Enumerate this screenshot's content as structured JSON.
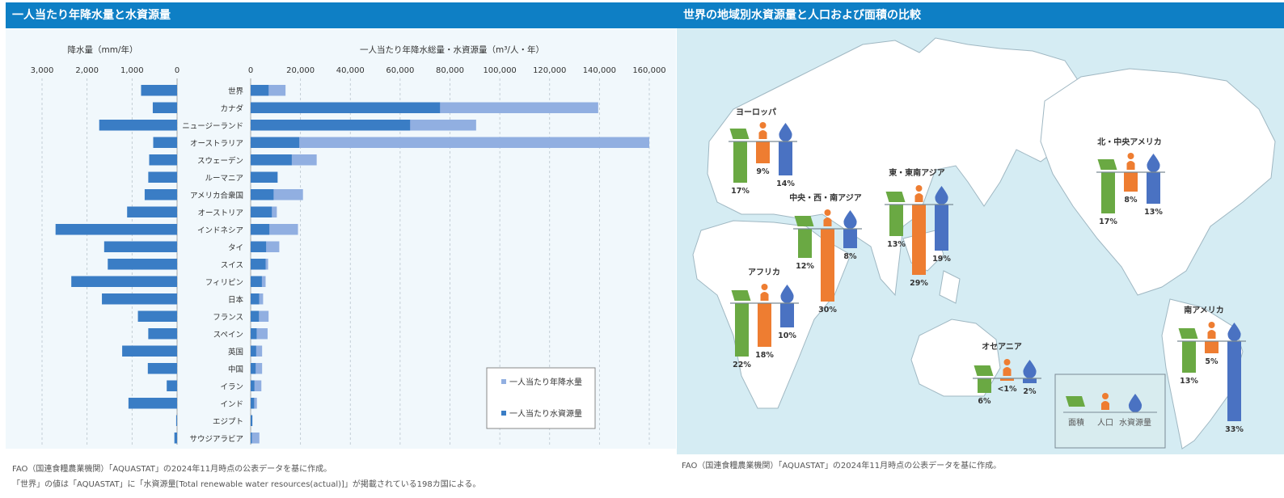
{
  "left_panel": {
    "title": "一人当たり年降水量と水資源量"
  },
  "right_panel": {
    "title": "世界の地域別水資源量と人口および面積の比較"
  },
  "notes": {
    "left_line1": "FAO（国連食糧農業機関）「AQUASTAT」の2024年11月時点の公表データを基に作成。",
    "left_line2": "「世界」の値は「AQUASTAT」に「水資源量[Total renewable water resources(actual)]」が掲載されている198カ国による。",
    "right_line1": "FAO（国連食糧農業機関）「AQUASTAT」の2024年11月時点の公表データを基に作成。"
  },
  "colors": {
    "resource": "#3a7dc5",
    "precip": "#91afe1",
    "area": "#6aa943",
    "population": "#ee7d31",
    "water": "#4a72c2"
  },
  "chart_data": [
    {
      "type": "bar",
      "orientation": "horizontal-reversed",
      "xlabel": "降水量（mm/年）",
      "xlim": [
        0,
        3000
      ],
      "ticks": [
        "3,000",
        "2,000",
        "1,000",
        "0"
      ],
      "tick_values": [
        3000,
        2000,
        1000,
        0
      ],
      "grid": true,
      "categories": [
        "世界",
        "カナダ",
        "ニュージーランド",
        "オーストラリア",
        "スウェーデン",
        "ルーマニア",
        "アメリカ合衆国",
        "オーストリア",
        "インドネシア",
        "タイ",
        "スイス",
        "フィリピン",
        "日本",
        "フランス",
        "スペイン",
        "英国",
        "中国",
        "イラン",
        "インド",
        "エジプト",
        "サウジアラビア"
      ],
      "values": [
        800,
        540,
        1730,
        530,
        620,
        640,
        720,
        1110,
        2700,
        1620,
        1540,
        2350,
        1670,
        870,
        640,
        1220,
        650,
        230,
        1080,
        20,
        60
      ]
    },
    {
      "type": "bar",
      "orientation": "horizontal",
      "xlabel": "一人当たり年降水総量・水資源量（m³/人・年）",
      "xlim": [
        0,
        160000
      ],
      "ticks": [
        "0",
        "20,000",
        "40,000",
        "60,000",
        "80,000",
        "100,000",
        "120,000",
        "140,000",
        "160,000"
      ],
      "tick_values": [
        0,
        20000,
        40000,
        60000,
        80000,
        100000,
        120000,
        140000,
        160000
      ],
      "grid": true,
      "legend_position": "bottom-right",
      "categories": [
        "世界",
        "カナダ",
        "ニュージーランド",
        "オーストラリア",
        "スウェーデン",
        "ルーマニア",
        "アメリカ合衆国",
        "オーストリア",
        "インドネシア",
        "タイ",
        "スイス",
        "フィリピン",
        "日本",
        "フランス",
        "スペイン",
        "英国",
        "中国",
        "イラン",
        "インド",
        "エジプト",
        "サウジアラビア"
      ],
      "series": [
        {
          "name": "一人当たり年降水量",
          "values": [
            14000,
            139500,
            90500,
            160000,
            26500,
            10800,
            21000,
            10500,
            19000,
            11500,
            7000,
            6000,
            5000,
            7200,
            6800,
            4600,
            4600,
            4300,
            2500,
            0,
            3500
          ]
        },
        {
          "name": "一人当たり水資源量",
          "values": [
            7200,
            76000,
            64000,
            19500,
            16500,
            10800,
            9200,
            8500,
            7500,
            6200,
            6000,
            4500,
            3400,
            3300,
            2400,
            2200,
            2000,
            1500,
            1400,
            700,
            100
          ]
        }
      ]
    },
    {
      "type": "bar",
      "title": "世界の地域別水資源量と人口および面積の比較",
      "legend": [
        "面積",
        "人口",
        "水資源量"
      ],
      "legend_position": "bottom-right",
      "unit": "%",
      "regions": [
        {
          "name": "ヨーロッパ",
          "area": 17,
          "population": 9,
          "water": 14,
          "labels": {
            "area": "17%",
            "population": "9%",
            "water": "14%"
          }
        },
        {
          "name": "中央・西・南アジア",
          "area": 12,
          "population": 30,
          "water": 8,
          "labels": {
            "area": "12%",
            "population": "30%",
            "water": "8%"
          }
        },
        {
          "name": "東・東南アジア",
          "area": 13,
          "population": 29,
          "water": 19,
          "labels": {
            "area": "13%",
            "population": "29%",
            "water": "19%"
          }
        },
        {
          "name": "北・中央アメリカ",
          "area": 17,
          "population": 8,
          "water": 13,
          "labels": {
            "area": "17%",
            "population": "8%",
            "water": "13%"
          }
        },
        {
          "name": "アフリカ",
          "area": 22,
          "population": 18,
          "water": 10,
          "labels": {
            "area": "22%",
            "population": "18%",
            "water": "10%"
          }
        },
        {
          "name": "オセアニア",
          "area": 6,
          "population": 1,
          "water": 2,
          "labels": {
            "area": "6%",
            "population": "<1%",
            "water": "2%"
          }
        },
        {
          "name": "南アメリカ",
          "area": 13,
          "population": 5,
          "water": 33,
          "labels": {
            "area": "13%",
            "population": "5%",
            "water": "33%"
          }
        }
      ]
    }
  ]
}
